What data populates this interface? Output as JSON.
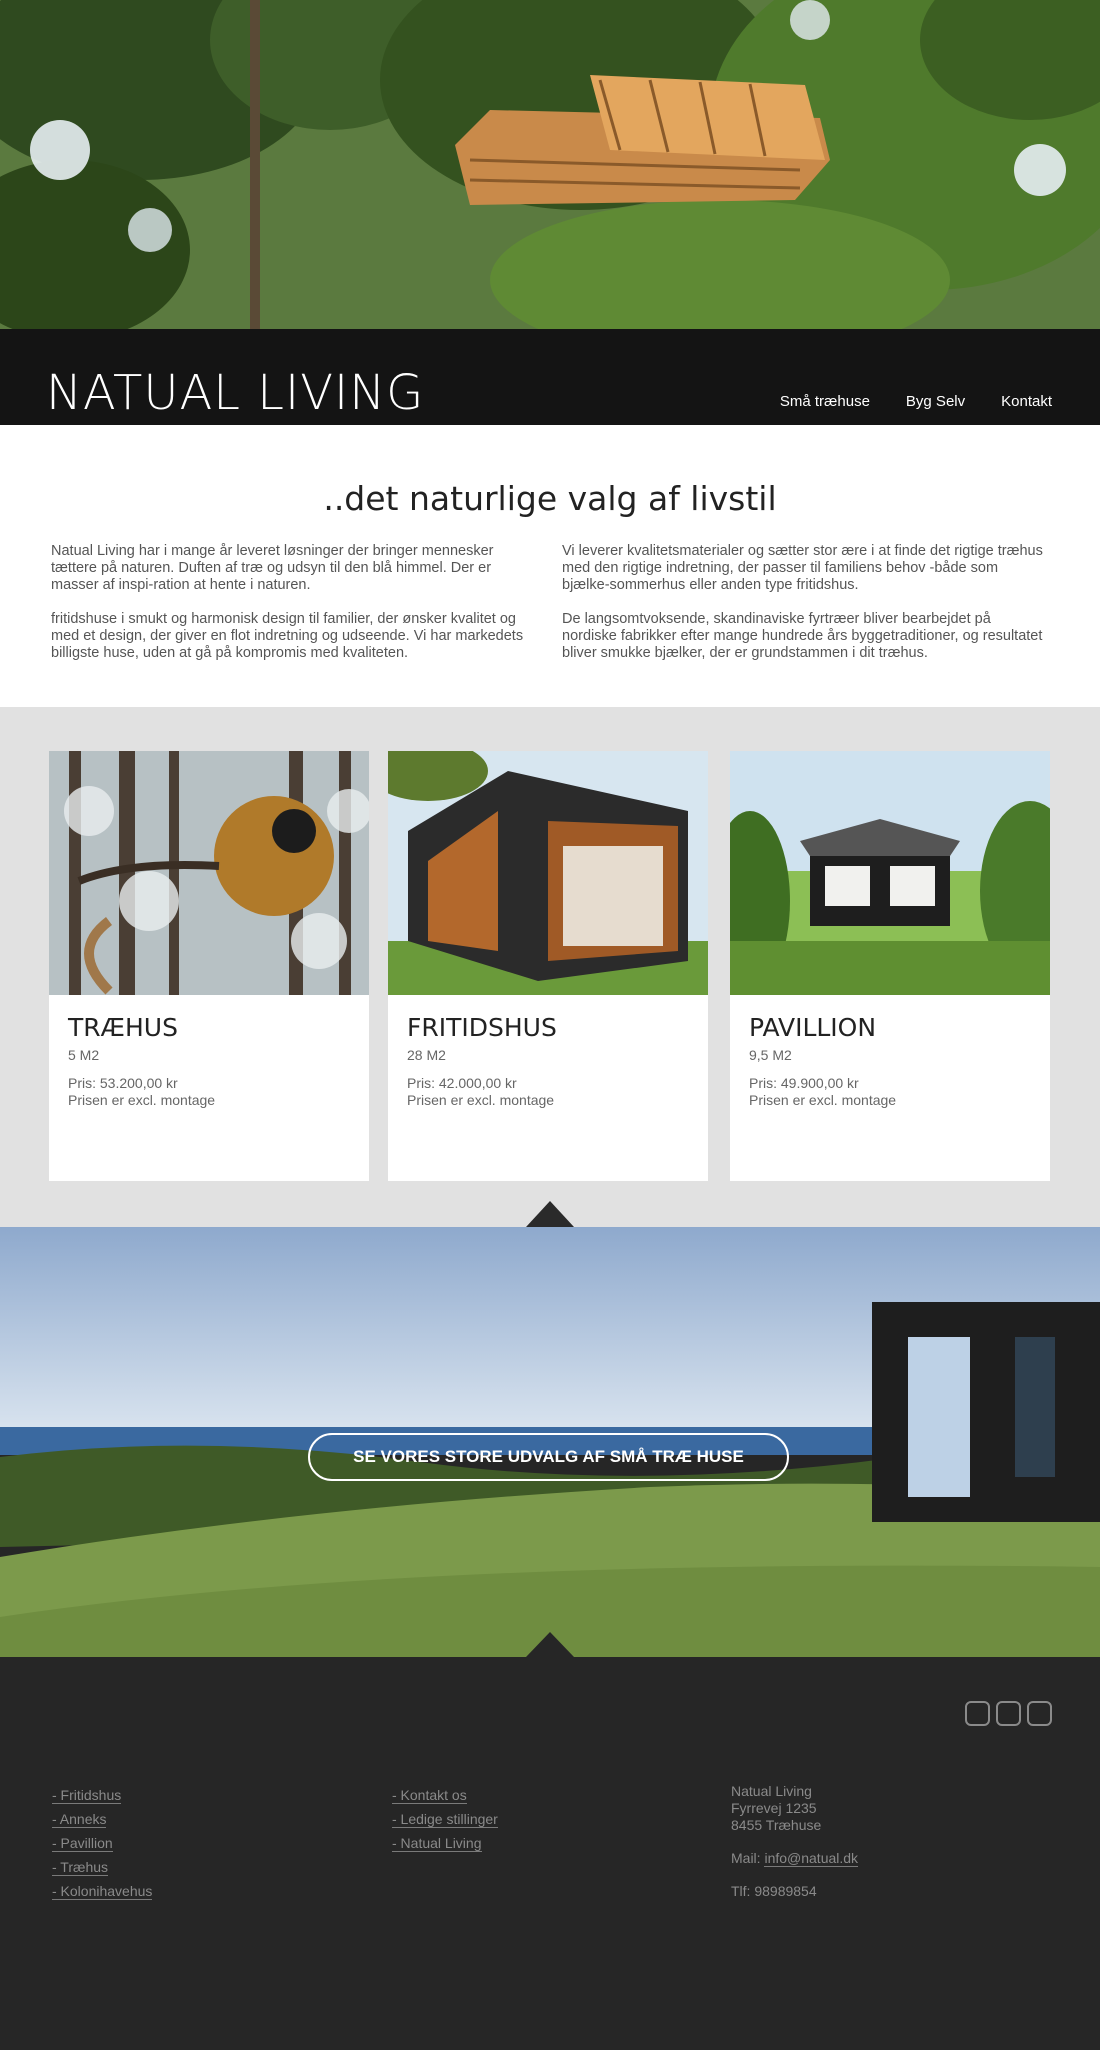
{
  "header": {
    "logo": "NATUAL LIVING",
    "nav": [
      "Små træhuse",
      "Byg Selv",
      "Kontakt"
    ]
  },
  "intro": {
    "heading": "..det naturlige valg af livstil",
    "left_p1": "Natual Living har i mange år leveret løsninger der bringer mennesker tættere på naturen. Duften af træ og udsyn til den blå himmel. Der er masser af inspi-ration at hente i naturen.",
    "left_p2": "fritidshuse i smukt og harmonisk design til familier, der ønsker kvalitet og med et design, der giver en flot indretning og udseende. Vi har markedets billigste huse, uden at gå på kompromis med kvaliteten.",
    "right_p1": "Vi leverer kvalitetsmaterialer og sætter stor ære i at finde det rigtige træhus med den rigtige indretning, der passer til familiens behov -både som bjælke-sommerhus eller anden type fritidshus.",
    "right_p2": "De langsomtvoksende, skandinaviske fyrtræer bliver bearbejdet på nordiske fabrikker efter mange hundrede års byggetraditioner, og resultatet bliver smukke bjælker, der er grundstammen i dit træhus."
  },
  "products": [
    {
      "name": "TRÆHUS",
      "size": "5 M2",
      "price": "Pris: 53.200,00 kr",
      "note": "Prisen er excl. montage"
    },
    {
      "name": "FRITIDSHUS",
      "size": "28 M2",
      "price": "Pris: 42.000,00 kr",
      "note": "Prisen er excl. montage"
    },
    {
      "name": "PAVILLION",
      "size": "9,5 M2",
      "price": "Pris: 49.900,00 kr",
      "note": "Prisen er excl. montage"
    }
  ],
  "cta": "SE VORES STORE UDVALG AF SMÅ TRÆ HUSE",
  "footer": {
    "col1": [
      "- Fritidshus",
      "- Anneks",
      "- Pavillion",
      "- Træhus",
      "- Kolonihavehus"
    ],
    "col2": [
      "- Kontakt os",
      "- Ledige stillinger",
      "- Natual Living"
    ],
    "company": "Natual Living",
    "street": "Fyrrevej 1235",
    "city": "8455 Træhuse",
    "mail_label": "Mail: ",
    "mail": "info@natual.dk",
    "phone": "Tlf: 98989854",
    "social_icons": [
      "facebook-icon",
      "pinterest-icon",
      "instagram-icon"
    ]
  }
}
